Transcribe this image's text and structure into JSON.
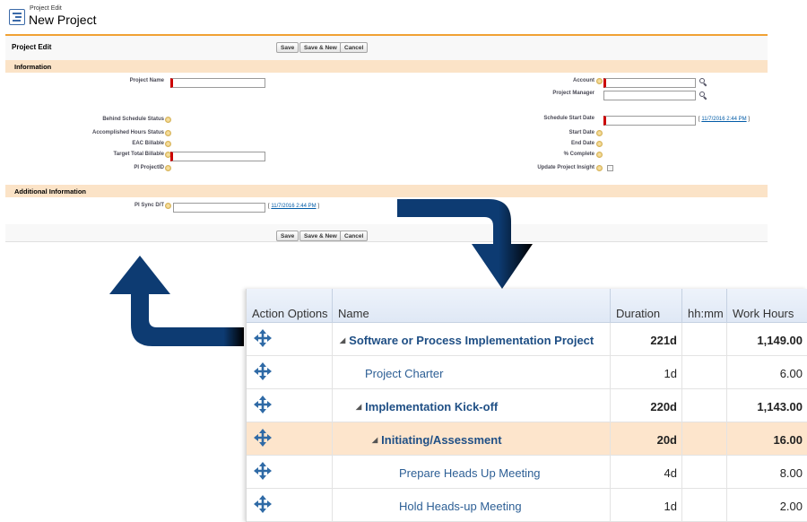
{
  "header": {
    "subtitle": "Project Edit",
    "title": "New Project"
  },
  "form": {
    "block_title": "Project Edit",
    "buttons": {
      "save": "Save",
      "save_new": "Save & New",
      "cancel": "Cancel"
    },
    "sections": {
      "information": "Information",
      "additional": "Additional Information"
    },
    "fields": {
      "project_name": "Project Name",
      "account": "Account",
      "project_manager": "Project Manager",
      "behind_schedule_status": "Behind Schedule Status",
      "schedule_start_date": "Schedule Start Date",
      "accomplished_hours_status": "Accomplished Hours Status",
      "start_date": "Start Date",
      "eac_billable": "EAC Billable",
      "end_date": "End Date",
      "target_total_billable": "Target Total Billable",
      "percent_complete": "% Complete",
      "pi_projectid": "PI ProjectID",
      "update_project_insight": "Update Project Insight",
      "pi_sync_dt": "PI Sync D/T"
    },
    "date_link": "11/7/2016 2:44 PM",
    "date_bracket_open": "[ ",
    "date_bracket_close": " ]"
  },
  "grid": {
    "columns": [
      "Action Options",
      "Name",
      "Duration",
      "hh:mm",
      "Work Hours"
    ],
    "rows": [
      {
        "name": "Software or Process Implementation Project",
        "duration": "221d",
        "hhmm": "",
        "work_hours": "1,149.00",
        "bold": true,
        "expander": "◢",
        "highlight": false
      },
      {
        "name": "Project Charter",
        "duration": "1d",
        "hhmm": "",
        "work_hours": "6.00",
        "bold": false,
        "expander": "",
        "highlight": false
      },
      {
        "name": "Implementation Kick-off",
        "duration": "220d",
        "hhmm": "",
        "work_hours": "1,143.00",
        "bold": true,
        "expander": "◢",
        "highlight": false
      },
      {
        "name": "Initiating/Assessment",
        "duration": "20d",
        "hhmm": "",
        "work_hours": "16.00",
        "bold": true,
        "expander": "◢",
        "highlight": true
      },
      {
        "name": "Prepare Heads Up Meeting",
        "duration": "4d",
        "hhmm": "",
        "work_hours": "8.00",
        "bold": false,
        "expander": "",
        "highlight": false
      },
      {
        "name": "Hold Heads-up Meeting",
        "duration": "1d",
        "hhmm": "",
        "work_hours": "2.00",
        "bold": false,
        "expander": "",
        "highlight": false
      }
    ]
  },
  "icons": {
    "app": "project-icon",
    "lookup": "magnifier-icon",
    "help": "help-bubble-icon",
    "move": "move-arrows-icon"
  },
  "colors": {
    "arrow": "#0d3b72",
    "accent_orange": "#f0a133",
    "section_bg": "#fbe3c7",
    "highlight_row": "#fde5cc",
    "grid_link": "#2d5f95"
  }
}
